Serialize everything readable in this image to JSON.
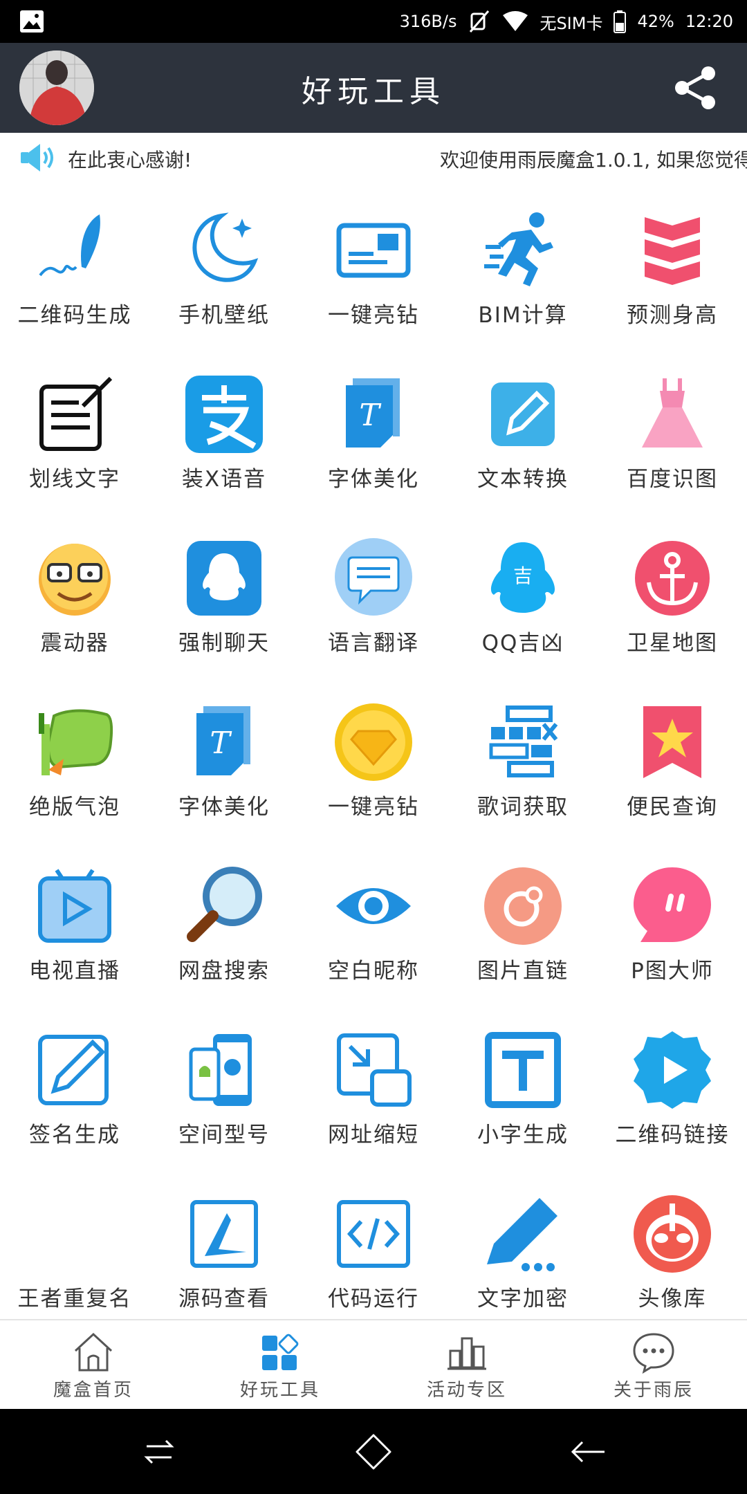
{
  "status": {
    "speed": "316B/s",
    "sim": "无SIM卡",
    "battery": "42%",
    "time": "12:20"
  },
  "header": {
    "title": "好玩工具"
  },
  "notice": {
    "left": "在此衷心感谢!",
    "scroll": "欢迎使用雨辰魔盒1.0.1, 如果您觉得"
  },
  "tools": [
    {
      "label": "二维码生成",
      "icon": "quill-icon"
    },
    {
      "label": "手机壁纸",
      "icon": "moon-icon"
    },
    {
      "label": "一键亮钻",
      "icon": "card-icon"
    },
    {
      "label": "BIM计算",
      "icon": "runner-icon"
    },
    {
      "label": "预测身高",
      "icon": "chevrons-icon"
    },
    {
      "label": "划线文字",
      "icon": "edit-doc-icon"
    },
    {
      "label": "装X语音",
      "icon": "alipay-icon"
    },
    {
      "label": "字体美化",
      "icon": "font-doc-icon"
    },
    {
      "label": "文本转换",
      "icon": "pencil-tile-icon"
    },
    {
      "label": "百度识图",
      "icon": "dress-icon"
    },
    {
      "label": "震动器",
      "icon": "face-icon"
    },
    {
      "label": "强制聊天",
      "icon": "qq-tile-icon"
    },
    {
      "label": "语言翻译",
      "icon": "chat-bubble-icon"
    },
    {
      "label": "QQ吉凶",
      "icon": "qq-penguin-icon"
    },
    {
      "label": "卫星地图",
      "icon": "anchor-icon"
    },
    {
      "label": "绝版气泡",
      "icon": "bubble-veg-icon"
    },
    {
      "label": "字体美化",
      "icon": "font-doc-icon"
    },
    {
      "label": "一键亮钻",
      "icon": "diamond-coin-icon"
    },
    {
      "label": "歌词获取",
      "icon": "bricks-icon"
    },
    {
      "label": "便民查询",
      "icon": "star-badge-icon"
    },
    {
      "label": "电视直播",
      "icon": "tv-icon"
    },
    {
      "label": "网盘搜索",
      "icon": "magnifier-icon"
    },
    {
      "label": "空白昵称",
      "icon": "eye-icon"
    },
    {
      "label": "图片直链",
      "icon": "link-circle-icon"
    },
    {
      "label": "P图大师",
      "icon": "pink-bubble-icon"
    },
    {
      "label": "签名生成",
      "icon": "sign-pen-icon"
    },
    {
      "label": "空间型号",
      "icon": "phones-icon"
    },
    {
      "label": "网址缩短",
      "icon": "shrink-icon"
    },
    {
      "label": "小字生成",
      "icon": "t-box-icon"
    },
    {
      "label": "二维码链接",
      "icon": "play-gear-icon"
    },
    {
      "label": "王者重复名",
      "icon": "blank-icon"
    },
    {
      "label": "源码查看",
      "icon": "source-icon"
    },
    {
      "label": "代码运行",
      "icon": "code-icon"
    },
    {
      "label": "文字加密",
      "icon": "pen-dots-icon"
    },
    {
      "label": "头像库",
      "icon": "ultraman-icon"
    }
  ],
  "tabs": [
    {
      "label": "魔盒首页",
      "icon": "home-icon"
    },
    {
      "label": "好玩工具",
      "icon": "grid-icon"
    },
    {
      "label": "活动专区",
      "icon": "podium-icon"
    },
    {
      "label": "关于雨辰",
      "icon": "message-icon"
    }
  ],
  "colors": {
    "header": "#2d333d",
    "blue": "#1f8fde",
    "pink": "#f0506e"
  }
}
